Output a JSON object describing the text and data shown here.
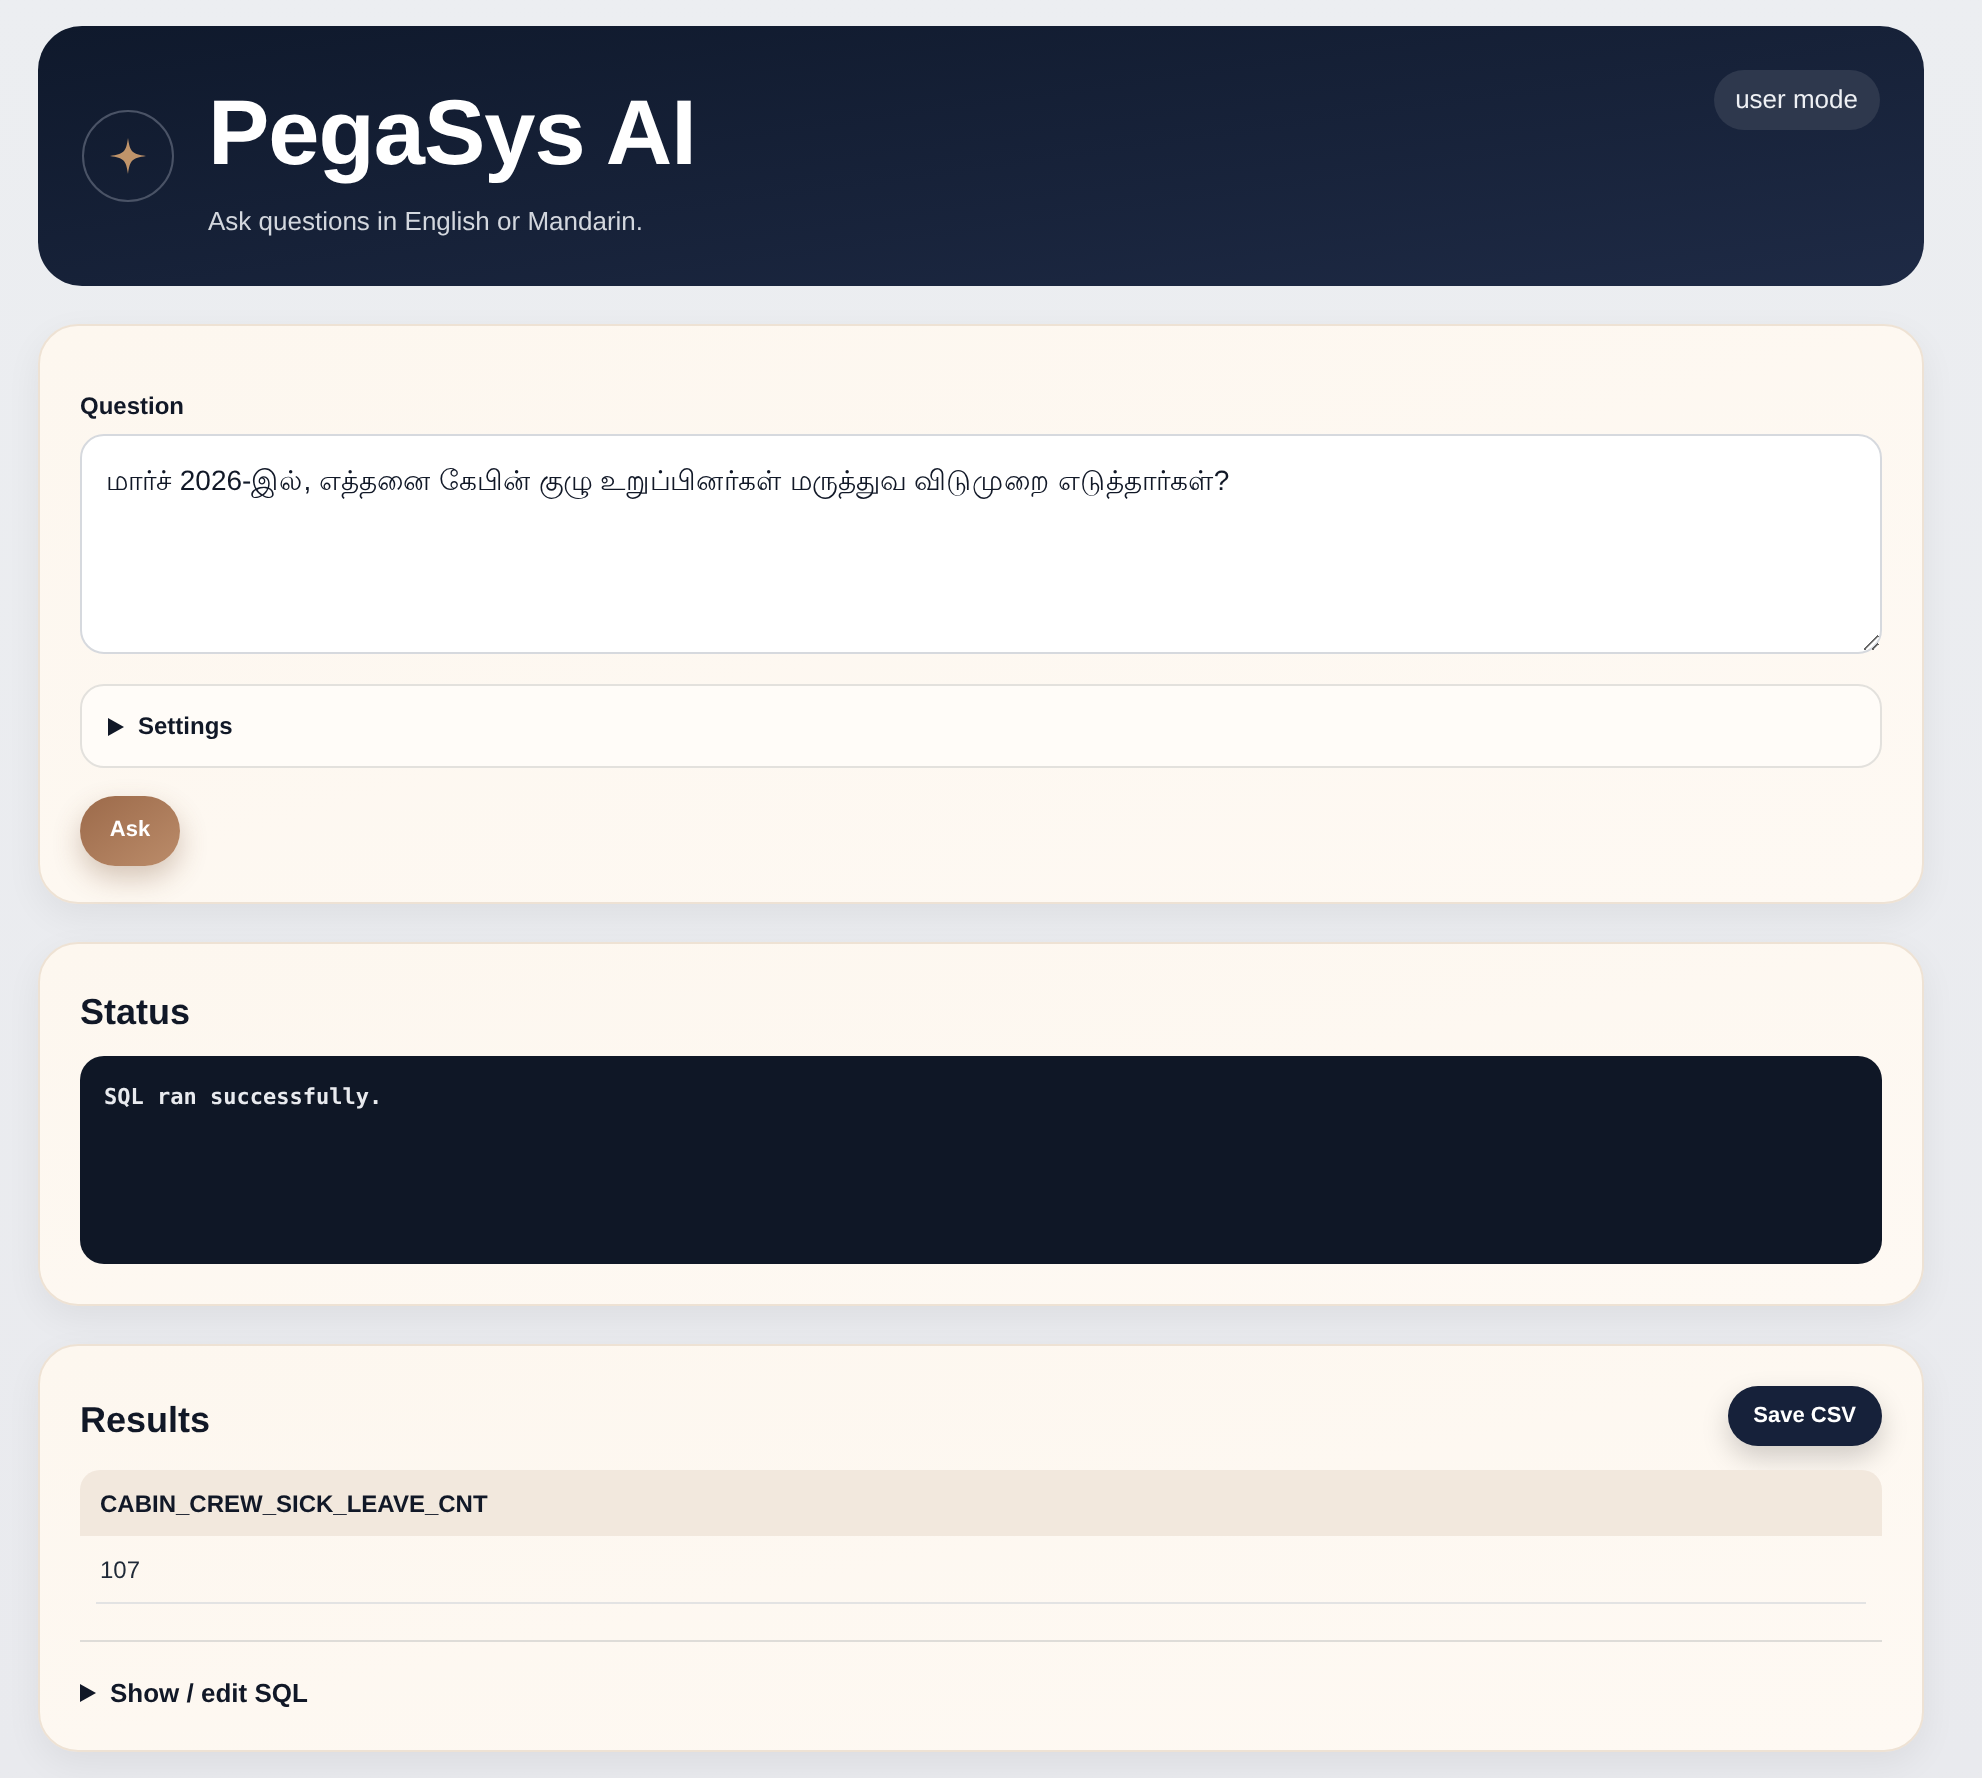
{
  "header": {
    "title": "PegaSys AI",
    "subtitle": "Ask questions in English or Mandarin.",
    "mode_badge": "user mode"
  },
  "question": {
    "label": "Question",
    "value": "மார்ச் 2026-இல், எத்தனை கேபின் குழு உறுப்பினர்கள் மருத்துவ விடுமுறை எடுத்தார்கள்?"
  },
  "settings": {
    "label": "Settings",
    "expanded": false
  },
  "ask_button": "Ask",
  "status": {
    "title": "Status",
    "message": "SQL ran successfully."
  },
  "results": {
    "title": "Results",
    "save_button": "Save CSV",
    "table": {
      "columns": [
        "CABIN_CREW_SICK_LEAVE_CNT"
      ],
      "rows": [
        [
          "107"
        ]
      ]
    },
    "sql_toggle": {
      "label": "Show / edit SQL",
      "expanded": false
    }
  }
}
